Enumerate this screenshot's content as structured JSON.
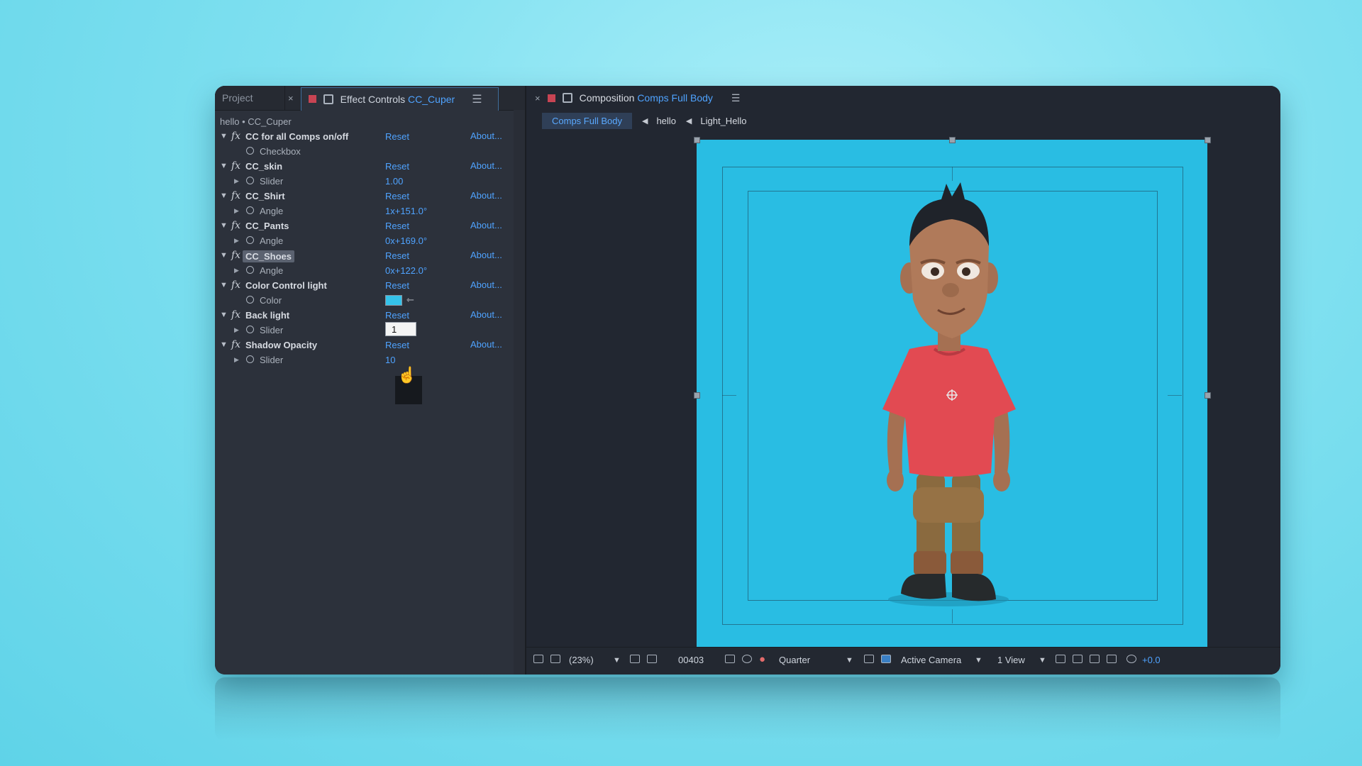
{
  "left_panel": {
    "tabs": {
      "project": "Project",
      "close": "×",
      "effect_controls_label": "Effect Controls",
      "effect_controls_layer": "CC_Cuper",
      "menu": "☰"
    },
    "breadcrumb": "hello • CC_Cuper",
    "effects": [
      {
        "name": "CC for all Comps on/off",
        "reset": "Reset",
        "about": "About...",
        "param": "Checkbox",
        "value": ""
      },
      {
        "name": "CC_skin",
        "reset": "Reset",
        "about": "About...",
        "param": "Slider",
        "value": "1.00"
      },
      {
        "name": "CC_Shirt",
        "reset": "Reset",
        "about": "About...",
        "param": "Angle",
        "value": "1x+151.0°"
      },
      {
        "name": "CC_Pants",
        "reset": "Reset",
        "about": "About...",
        "param": "Angle",
        "value": "0x+169.0°"
      },
      {
        "name": "CC_Shoes",
        "reset": "Reset",
        "about": "About...",
        "param": "Angle",
        "value": "0x+122.0°"
      },
      {
        "name": "Color Control light",
        "reset": "Reset",
        "about": "About...",
        "param": "Color",
        "value": ""
      },
      {
        "name": "Back light",
        "reset": "Reset",
        "about": "About...",
        "param": "Slider",
        "value": "1"
      },
      {
        "name": "Shadow Opacity",
        "reset": "Reset",
        "about": "About...",
        "param": "Slider",
        "value": "10"
      }
    ],
    "color_swatch": "#35c3ea"
  },
  "composition": {
    "tab_label": "Composition",
    "tab_comp": "Comps Full Body",
    "menu": "☰",
    "breadcrumbs": [
      "Comps Full Body",
      "hello",
      "Light_Hello"
    ],
    "background_color": "#29bde3"
  },
  "toolbar": {
    "zoom": "(23%)",
    "timecode": "00403",
    "resolution": "Quarter",
    "camera": "Active Camera",
    "views": "1 View",
    "exposure": "+0.0"
  }
}
